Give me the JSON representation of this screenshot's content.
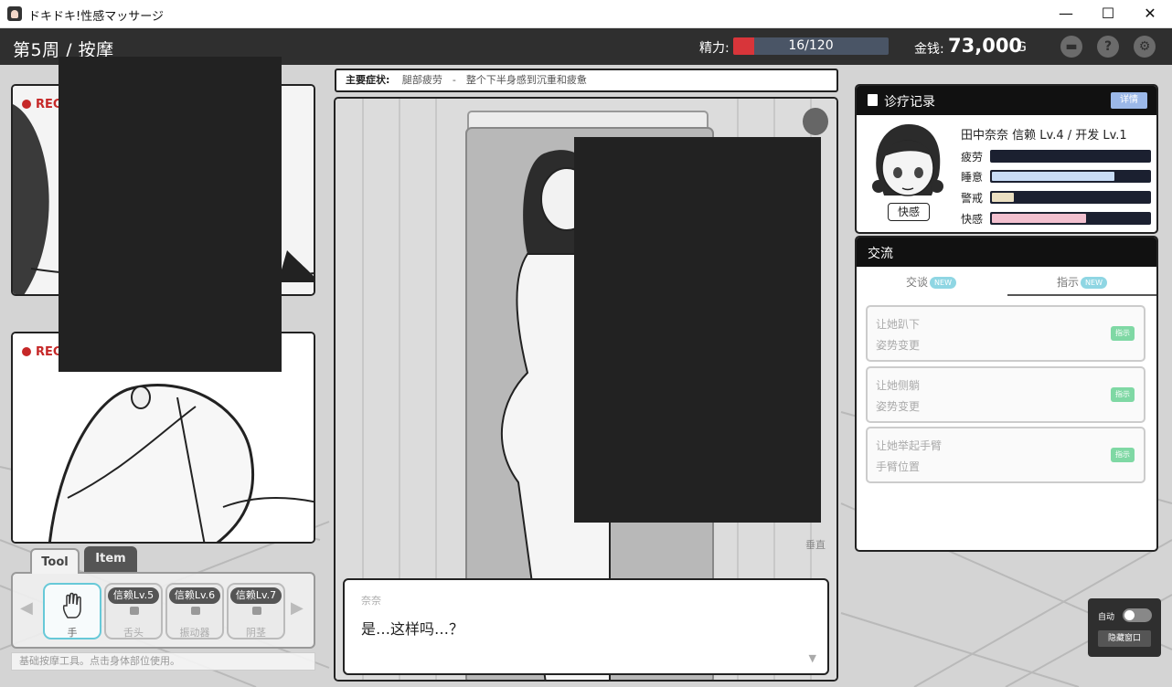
{
  "window": {
    "title": "ドキドキ!性感マッサージ",
    "minimize": "—",
    "maximize": "☐",
    "close": "✕"
  },
  "hud": {
    "week_title": "第5周 / 按摩",
    "stamina_label": "精力:",
    "stamina_text": "16/120",
    "stamina_value": 16,
    "stamina_max": 120,
    "money_label": "金钱:",
    "money_value": "73,000",
    "money_unit": "G",
    "icons": [
      "chat-icon",
      "help-icon",
      "gear-icon"
    ],
    "help_glyph": "?",
    "gear_glyph": "⚙",
    "chat_glyph": "▬"
  },
  "rec": {
    "label": "REC"
  },
  "tools": {
    "tab_tool": "Tool",
    "tab_item": "Item",
    "prev": "◀",
    "next": "▶",
    "slots": [
      {
        "label": "手",
        "badge": ""
      },
      {
        "label": "舌头",
        "badge": "信赖Lv.5"
      },
      {
        "label": "振动器",
        "badge": "信赖Lv.6"
      },
      {
        "label": "阴茎",
        "badge": "信赖Lv.7"
      }
    ],
    "description": "基础按摩工具。点击身体部位使用。"
  },
  "symptom": {
    "label": "主要症状:",
    "text": "腿部疲劳　-　整个下半身感到沉重和疲惫"
  },
  "stage": {
    "side_button": "垂直"
  },
  "dialogue": {
    "speaker": "奈奈",
    "line": "是…这样吗…？",
    "next": "▼"
  },
  "record": {
    "title": "诊疗记录",
    "detail_button": "详情",
    "char_name": "田中奈奈 信赖 Lv.4 / 开发 Lv.1",
    "kaikan_button": "快感",
    "stats": [
      {
        "label": "疲劳",
        "value": 0.0,
        "color": "#1b2030"
      },
      {
        "label": "睡意",
        "value": 0.78,
        "color": "#c8dcf6"
      },
      {
        "label": "警戒",
        "value": 0.14,
        "color": "#eadfc2"
      },
      {
        "label": "快感",
        "value": 0.6,
        "color": "#f2c0cf"
      }
    ]
  },
  "exchange": {
    "title": "交流",
    "tab_talk": "交谈",
    "tab_instruct": "指示",
    "new_badge": "NEW",
    "actions": [
      {
        "title": "让她趴下",
        "sub": "姿势变更",
        "tag": "指示"
      },
      {
        "title": "让她侧躺",
        "sub": "姿势变更",
        "tag": "指示"
      },
      {
        "title": "让她举起手臂",
        "sub": "手臂位置",
        "tag": "指示"
      }
    ]
  },
  "auto": {
    "label": "自动",
    "hide_button": "隐藏窗口"
  }
}
